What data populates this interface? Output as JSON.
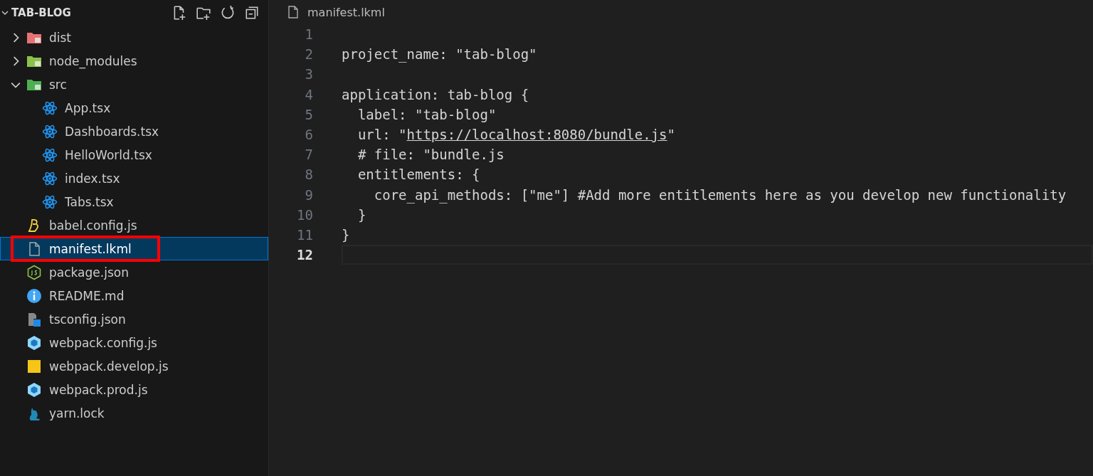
{
  "explorer": {
    "title": "TAB-BLOG",
    "expanded": true,
    "items": [
      {
        "name": "dist",
        "kind": "dist-folder",
        "expanded": false,
        "selected": false,
        "annotated": false
      },
      {
        "name": "node_modules",
        "kind": "node-folder",
        "expanded": false,
        "selected": false,
        "annotated": false
      },
      {
        "name": "src",
        "kind": "src-folder",
        "expanded": true,
        "selected": false,
        "annotated": false,
        "children": [
          {
            "name": "App.tsx",
            "kind": "react",
            "selected": false,
            "annotated": false
          },
          {
            "name": "Dashboards.tsx",
            "kind": "react",
            "selected": false,
            "annotated": false
          },
          {
            "name": "HelloWorld.tsx",
            "kind": "react",
            "selected": false,
            "annotated": false
          },
          {
            "name": "index.tsx",
            "kind": "react",
            "selected": false,
            "annotated": false
          },
          {
            "name": "Tabs.tsx",
            "kind": "react",
            "selected": false,
            "annotated": false
          }
        ]
      },
      {
        "name": "babel.config.js",
        "kind": "babel",
        "selected": false,
        "annotated": false
      },
      {
        "name": "manifest.lkml",
        "kind": "file",
        "selected": true,
        "annotated": true
      },
      {
        "name": "package.json",
        "kind": "node",
        "selected": false,
        "annotated": false
      },
      {
        "name": "README.md",
        "kind": "info",
        "selected": false,
        "annotated": false
      },
      {
        "name": "tsconfig.json",
        "kind": "tsconfig",
        "selected": false,
        "annotated": false
      },
      {
        "name": "webpack.config.js",
        "kind": "webpack",
        "selected": false,
        "annotated": false
      },
      {
        "name": "webpack.develop.js",
        "kind": "js",
        "selected": false,
        "annotated": false
      },
      {
        "name": "webpack.prod.js",
        "kind": "webpack",
        "selected": false,
        "annotated": false
      },
      {
        "name": "yarn.lock",
        "kind": "yarn",
        "selected": false,
        "annotated": false
      }
    ]
  },
  "editor": {
    "tab": "manifest.lkml",
    "lines": [
      {
        "number": "1",
        "current": false
      },
      {
        "number": "2",
        "current": false,
        "parts": [
          {
            "text": "project_name: \"tab-blog\"",
            "kind": "plain"
          }
        ]
      },
      {
        "number": "3",
        "current": false
      },
      {
        "number": "4",
        "current": false,
        "parts": [
          {
            "text": "application: tab-blog {",
            "kind": "plain"
          }
        ]
      },
      {
        "number": "5",
        "current": false,
        "parts": [
          {
            "text": "  label: \"tab-blog\"",
            "kind": "plain"
          }
        ]
      },
      {
        "number": "6",
        "current": false,
        "parts": [
          {
            "text": "  url: \"",
            "kind": "plain"
          },
          {
            "text": "https://localhost:8080/bundle.js",
            "kind": "link"
          },
          {
            "text": "\"",
            "kind": "plain"
          }
        ]
      },
      {
        "number": "7",
        "current": false,
        "parts": [
          {
            "text": "  # file: \"bundle.js",
            "kind": "plain"
          }
        ]
      },
      {
        "number": "8",
        "current": false,
        "parts": [
          {
            "text": "  entitlements: {",
            "kind": "plain"
          }
        ]
      },
      {
        "number": "9",
        "current": false,
        "parts": [
          {
            "text": "    core_api_methods: [\"me\"] #Add more entitlements here as you develop new functionality",
            "kind": "plain"
          }
        ]
      },
      {
        "number": "10",
        "current": false,
        "parts": [
          {
            "text": "  }",
            "kind": "plain"
          }
        ]
      },
      {
        "number": "11",
        "current": false,
        "parts": [
          {
            "text": "}",
            "kind": "plain"
          }
        ]
      },
      {
        "number": "12",
        "current": true
      }
    ]
  }
}
